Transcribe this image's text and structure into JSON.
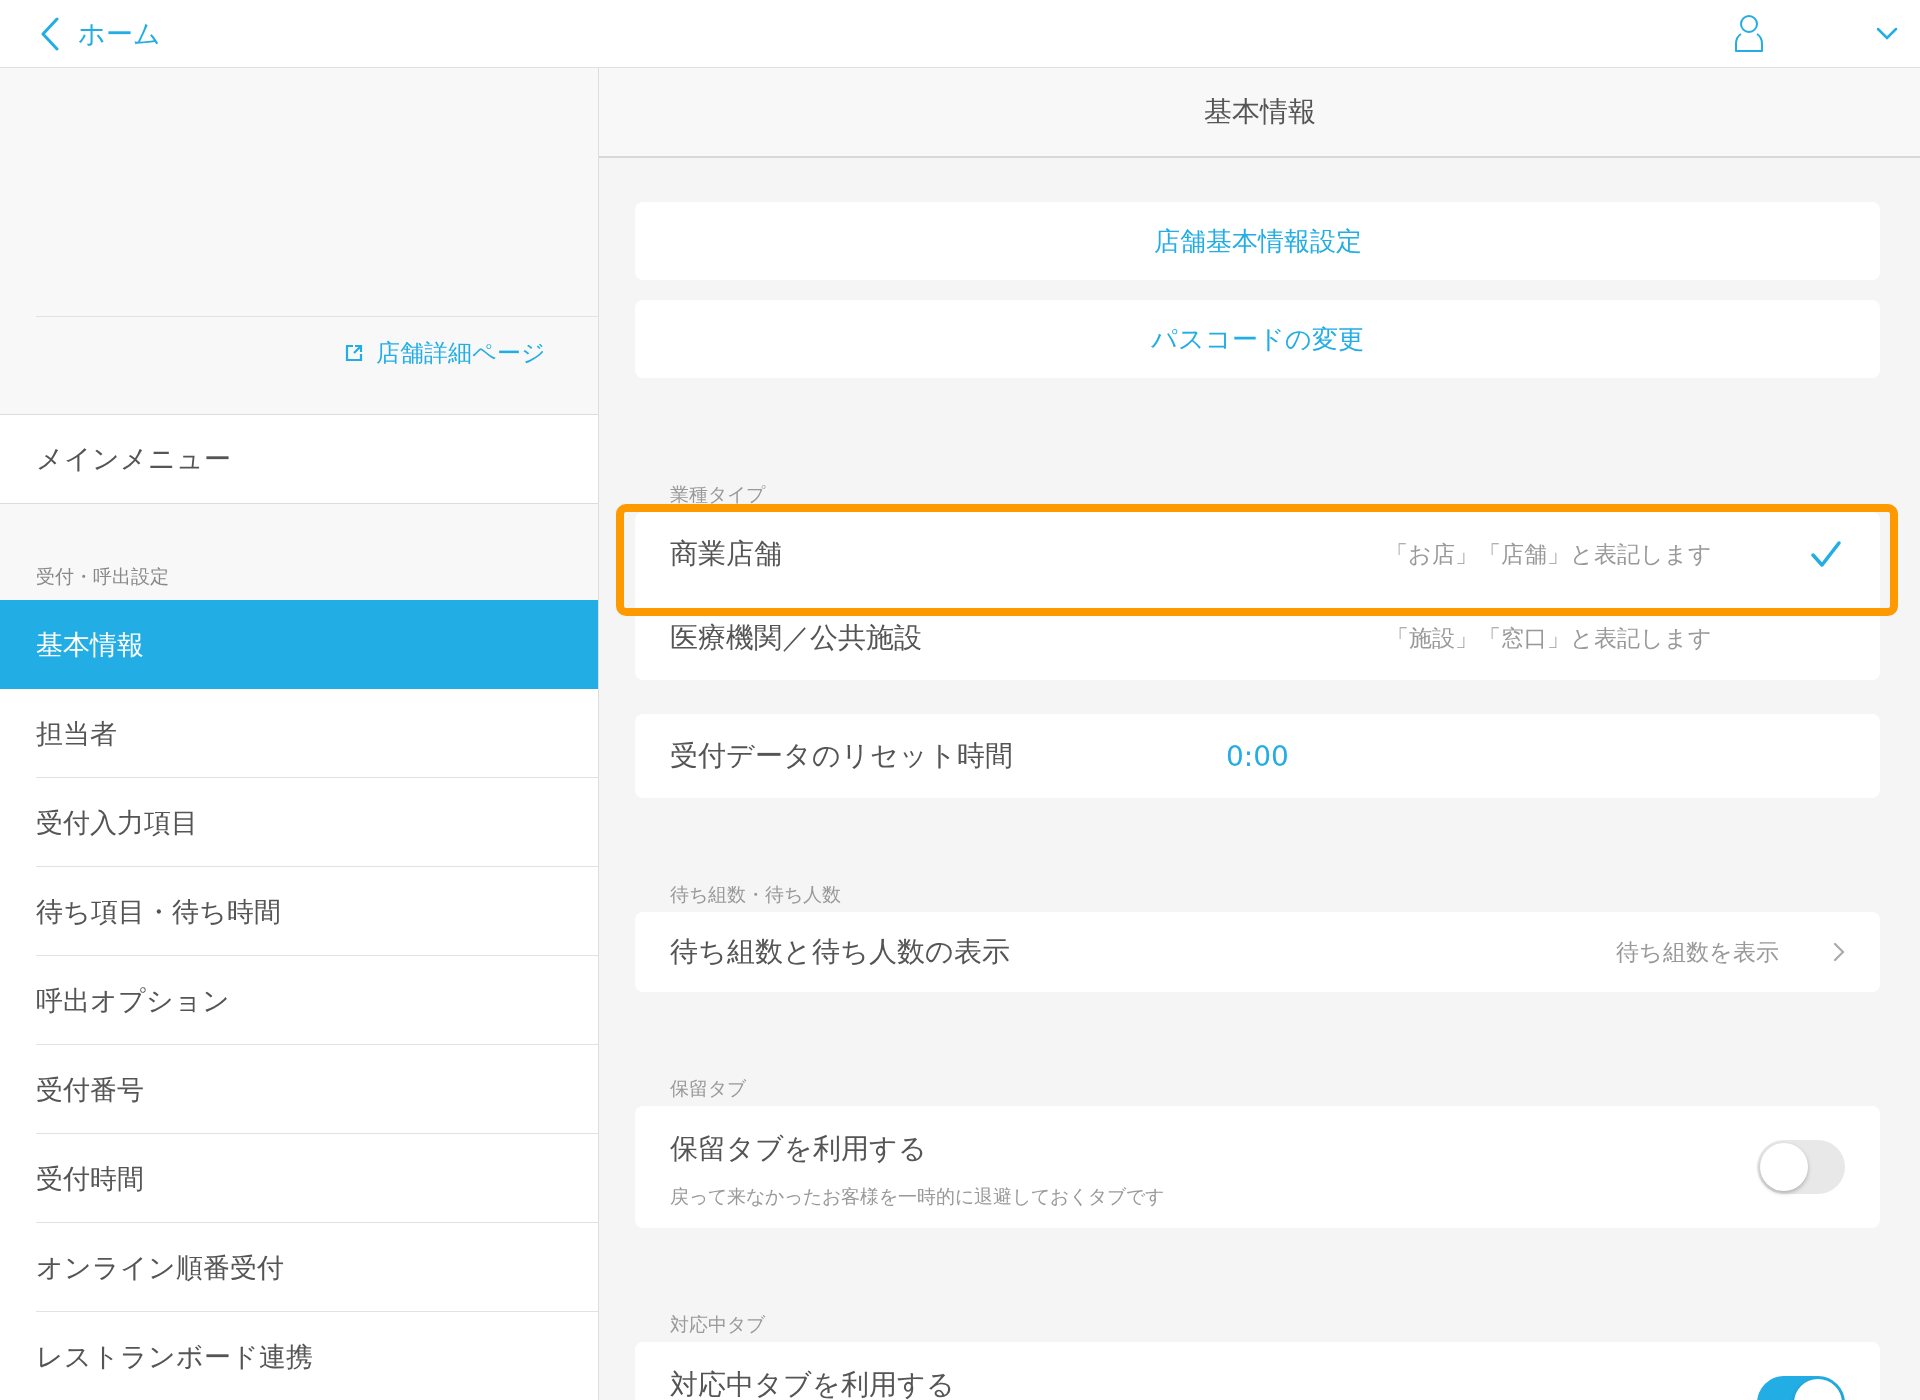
{
  "header": {
    "back_label": "ホーム"
  },
  "sidebar": {
    "store_link": "店舗詳細ページ",
    "main_menu": "メインメニュー",
    "section_label": "受付・呼出設定",
    "items": [
      {
        "label": "基本情報",
        "selected": true
      },
      {
        "label": "担当者",
        "selected": false
      },
      {
        "label": "受付入力項目",
        "selected": false
      },
      {
        "label": "待ち項目・待ち時間",
        "selected": false
      },
      {
        "label": "呼出オプション",
        "selected": false
      },
      {
        "label": "受付番号",
        "selected": false
      },
      {
        "label": "受付時間",
        "selected": false
      },
      {
        "label": "オンライン順番受付",
        "selected": false
      },
      {
        "label": "レストランボード連携",
        "selected": false
      }
    ]
  },
  "main": {
    "title": "基本情報",
    "buttons": [
      "店舗基本情報設定",
      "パスコードの変更"
    ],
    "sections": [
      {
        "kind": "choice",
        "heading": "業種タイプ",
        "options": [
          {
            "label": "商業店舗",
            "note": "「お店」「店舗」と表記します",
            "selected": true,
            "highlighted": true
          },
          {
            "label": "医療機関／公共施設",
            "note": "「施設」「窓口」と表記します",
            "selected": false,
            "highlighted": false
          }
        ]
      },
      {
        "kind": "value",
        "label": "受付データのリセット時間",
        "value": "0:00"
      },
      {
        "kind": "link",
        "heading": "待ち組数・待ち人数",
        "label": "待ち組数と待ち人数の表示",
        "value": "待ち組数を表示"
      },
      {
        "kind": "toggle",
        "heading": "保留タブ",
        "label": "保留タブを利用する",
        "description": "戻って来なかったお客様を一時的に退避しておくタブです",
        "on": false
      },
      {
        "kind": "toggle",
        "heading": "対応中タブ",
        "label": "対応中タブを利用する",
        "on": true
      }
    ]
  }
}
